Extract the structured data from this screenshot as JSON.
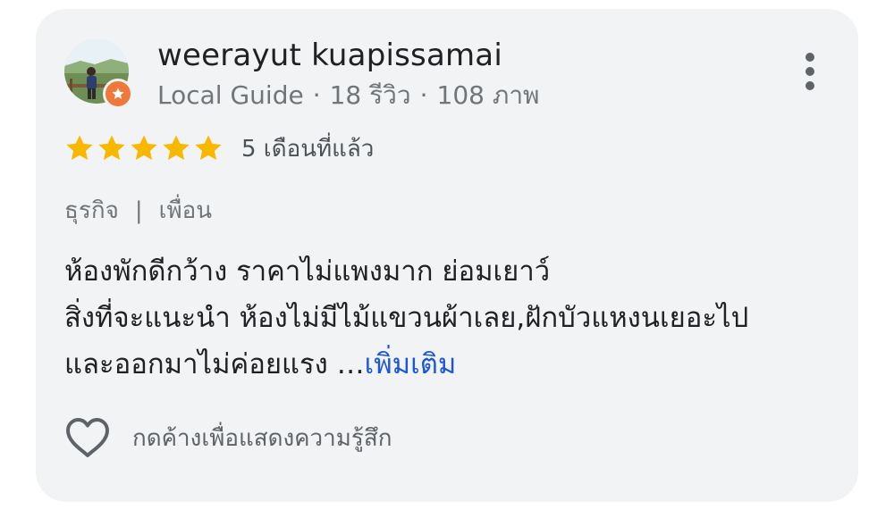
{
  "reviewer": {
    "name": "weerayut kuapissamai",
    "badge": "Local Guide",
    "reviews": "18 รีวิว",
    "photos": "108 ภาพ",
    "separator": "·"
  },
  "rating": {
    "stars": 5,
    "max_stars": 5,
    "time_ago": "5 เดือนที่แล้ว",
    "star_color": "#f9b800"
  },
  "tags": {
    "items": [
      "ธุรกิจ",
      "เพื่อน"
    ],
    "separator": "|"
  },
  "review": {
    "lines": [
      "ห้องพักดีกว้าง ราคาไม่แพงมาก ย่อมเยาว์",
      "สิ่งที่จะแนะนำ ห้องไม่มีไม้แขวนผ้าเลย,ฝักบัวแหงนเยอะไป",
      "และออกมาไม่ค่อยแรง …"
    ],
    "more_label": "เพิ่มเติม",
    "link_color": "#1a56d6"
  },
  "actions": {
    "like_label": "กดค้างเพื่อแสดงความรู้สึก",
    "like_icon": "heart-outline-icon",
    "menu_icon": "more-vertical-icon"
  }
}
